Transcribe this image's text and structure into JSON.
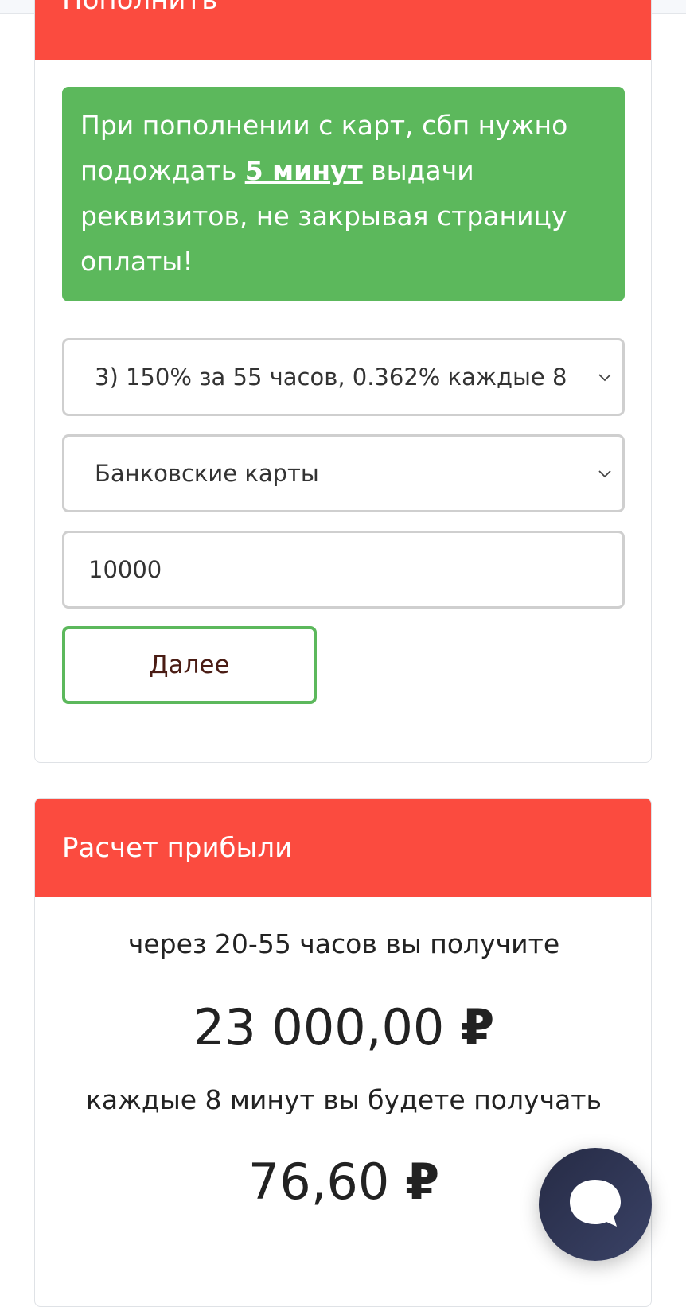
{
  "topup_card": {
    "header_title": "Пополнить",
    "notice": {
      "text_before": "При пополнении с карт, сбп нужно подождать ",
      "highlight": "5 минут",
      "text_after": " выдачи реквизитов, не закрывая страницу оплаты!"
    },
    "plan_select": {
      "selected": "3) 150% за 55 часов, 0.362% каждые 8"
    },
    "method_select": {
      "selected": "Банковские карты"
    },
    "amount_input": {
      "value": "10000"
    },
    "next_button_label": "Далее"
  },
  "profit_card": {
    "header_title": "Расчет прибыли",
    "line1": "через 20-55 часов вы получите",
    "total_amount": "23 000,00",
    "line2": "каждые 8 минут вы будете получать",
    "periodic_amount": "76,60",
    "currency_symbol": "₽"
  },
  "colors": {
    "header_red": "#fb4b3f",
    "notice_green": "#5cb85c",
    "chat_bubble": "#2f3553"
  },
  "icons": [
    "chevron-down-icon",
    "chat-icon"
  ]
}
